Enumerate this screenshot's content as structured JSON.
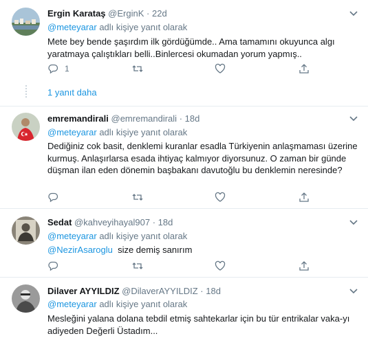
{
  "tweets": [
    {
      "name": "Ergin Karataş",
      "handle": "@ErginK",
      "separator": "·",
      "time": "22d",
      "reply_prefix": "@meteyarar",
      "reply_suffix": " adlı kişiye yanıt olarak",
      "text": "Mete bey bende şaşırdım ilk gördüğümde.. Ama tamamını okuyunca algı yaratmaya çalıştıkları belli..Binlercesi okumadan yorum yapmış..",
      "reply_count": "1",
      "more_replies": "1 yanıt daha"
    },
    {
      "name": "emremandirali",
      "handle": "@emremandirali",
      "separator": "·",
      "time": "18d",
      "reply_prefix": "@meteyarar",
      "reply_suffix": " adlı kişiye yanıt olarak",
      "text": "Dediğiniz cok basit, denklemi kuranlar esadla Türkiyenin anlaşmaması üzerine kurmuş. Anlaşırlarsa esada ihtiyaç kalmıyor diyorsunuz. O zaman bir günde düşman ilan eden dönemin başbakanı davutoğlu bu denklemin neresinde?"
    },
    {
      "name": "Sedat",
      "handle": "@kahveyihayal907",
      "separator": "·",
      "time": "18d",
      "reply_prefix": "@meteyarar",
      "reply_suffix": " adlı kişiye yanıt olarak",
      "mention": "@NezirAsaroglu",
      "text": "  size demiş sanırım"
    },
    {
      "name": "Dilaver AYYILDIZ",
      "handle": "@DilaverAYYILDIZ",
      "separator": "·",
      "time": "18d",
      "reply_prefix": "@meteyarar",
      "reply_suffix": " adlı kişiye yanıt olarak",
      "text": "Mesleğini yalana dolana tebdil etmiş sahtekarlar için bu tür entrikalar vaka-yı adiyeden Değerli Üstadım..."
    }
  ],
  "colors": {
    "link": "#1b95e0",
    "muted": "#657786",
    "text": "#14171a",
    "divider": "#e6ecf0"
  },
  "icons": [
    "reply-icon",
    "retweet-icon",
    "like-icon",
    "share-icon",
    "chevron-down-icon"
  ]
}
